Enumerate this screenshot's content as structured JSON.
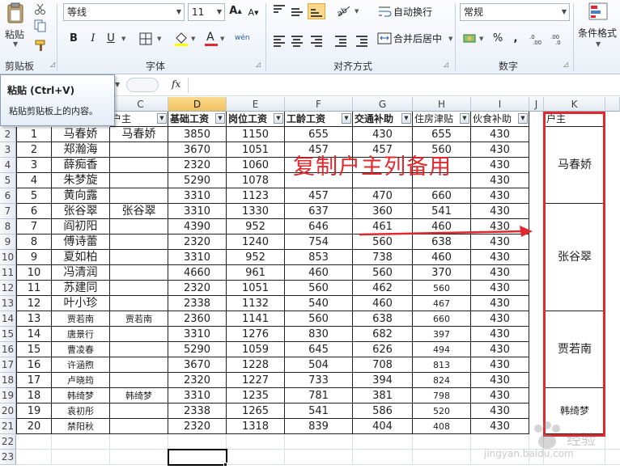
{
  "ribbon": {
    "clipboard": {
      "label": "剪贴板",
      "paste_label": "粘贴"
    },
    "font": {
      "label": "字体",
      "font_name": "等线",
      "font_size": "11",
      "bold": "B",
      "italic": "I",
      "underline": "U",
      "grow": "A",
      "shrink": "A",
      "color_letter": "A",
      "phonetic": "wén"
    },
    "alignment": {
      "label": "对齐方式",
      "wrap": "自动换行",
      "merge": "合并后居中"
    },
    "number": {
      "label": "数字",
      "format": "常规",
      "percent": "%",
      "comma": ","
    },
    "styles": {
      "conditional": "条件格式"
    }
  },
  "tooltip": {
    "title": "粘贴 (Ctrl+V)",
    "desc": "粘贴剪贴板上的内容。"
  },
  "formula": {
    "fx": "fx"
  },
  "columns": [
    "C",
    "D",
    "E",
    "F",
    "G",
    "H",
    "I",
    "J",
    "K"
  ],
  "headers": {
    "owner": "户主",
    "base": "基础工资",
    "post": "岗位工资",
    "seniority": "工龄工资",
    "traffic": "交通补助",
    "housing": "住房津贴",
    "meal": "伙食补助",
    "k_owner": "户主"
  },
  "rows": [
    {
      "row": "2",
      "idx": "1",
      "name": "马春娇",
      "owner": "马春娇",
      "d": "3850",
      "e": "1150",
      "f": "655",
      "g": "430",
      "h": "655",
      "i": "430"
    },
    {
      "row": "3",
      "idx": "2",
      "name": "郑瀚海",
      "owner": "",
      "d": "3670",
      "e": "1051",
      "f": "457",
      "g": "457",
      "h": "560",
      "i": "430"
    },
    {
      "row": "4",
      "idx": "3",
      "name": "薛痴香",
      "owner": "",
      "d": "2320",
      "e": "1060",
      "f": "",
      "g": "",
      "h": "",
      "i": "430"
    },
    {
      "row": "5",
      "idx": "4",
      "name": "朱梦旋",
      "owner": "",
      "d": "5290",
      "e": "1078",
      "f": "",
      "g": "",
      "h": "",
      "i": "430"
    },
    {
      "row": "6",
      "idx": "5",
      "name": "黄向露",
      "owner": "",
      "d": "3310",
      "e": "1123",
      "f": "457",
      "g": "470",
      "h": "660",
      "i": "430"
    },
    {
      "row": "7",
      "idx": "6",
      "name": "张谷翠",
      "owner": "张谷翠",
      "d": "3310",
      "e": "1330",
      "f": "637",
      "g": "360",
      "h": "541",
      "i": "430"
    },
    {
      "row": "8",
      "idx": "7",
      "name": "阎初阳",
      "owner": "",
      "d": "4390",
      "e": "952",
      "f": "646",
      "g": "461",
      "h": "460",
      "i": "430"
    },
    {
      "row": "9",
      "idx": "8",
      "name": "傅诗蕾",
      "owner": "",
      "d": "2320",
      "e": "1240",
      "f": "754",
      "g": "560",
      "h": "638",
      "i": "430"
    },
    {
      "row": "10",
      "idx": "9",
      "name": "夏如柏",
      "owner": "",
      "d": "3310",
      "e": "952",
      "f": "853",
      "g": "738",
      "h": "460",
      "i": "430"
    },
    {
      "row": "11",
      "idx": "10",
      "name": "冯清润",
      "owner": "",
      "d": "4660",
      "e": "961",
      "f": "460",
      "g": "560",
      "h": "370",
      "i": "430"
    },
    {
      "row": "12",
      "idx": "11",
      "name": "苏建同",
      "owner": "",
      "d": "2320",
      "e": "1051",
      "f": "560",
      "g": "462",
      "h": "560",
      "i": "430"
    },
    {
      "row": "13",
      "idx": "12",
      "name": "叶小珍",
      "owner": "",
      "d": "2338",
      "e": "1132",
      "f": "540",
      "g": "460",
      "h": "467",
      "i": "430"
    },
    {
      "row": "14",
      "idx": "13",
      "name": "贾若南",
      "owner": "贾若南",
      "d": "2360",
      "e": "1141",
      "f": "560",
      "g": "638",
      "h": "660",
      "i": "430"
    },
    {
      "row": "15",
      "idx": "14",
      "name": "唐景行",
      "owner": "",
      "d": "3310",
      "e": "1276",
      "f": "830",
      "g": "682",
      "h": "397",
      "i": "430"
    },
    {
      "row": "16",
      "idx": "15",
      "name": "曹凌春",
      "owner": "",
      "d": "5290",
      "e": "1059",
      "f": "645",
      "g": "626",
      "h": "494",
      "i": "430"
    },
    {
      "row": "17",
      "idx": "16",
      "name": "许涵煦",
      "owner": "",
      "d": "3670",
      "e": "1228",
      "f": "504",
      "g": "708",
      "h": "813",
      "i": "430"
    },
    {
      "row": "18",
      "idx": "17",
      "name": "卢晓筠",
      "owner": "",
      "d": "2320",
      "e": "1227",
      "f": "733",
      "g": "394",
      "h": "824",
      "i": "430"
    },
    {
      "row": "19",
      "idx": "18",
      "name": "韩绮梦",
      "owner": "韩绮梦",
      "d": "3310",
      "e": "1235",
      "f": "781",
      "g": "381",
      "h": "798",
      "i": "430"
    },
    {
      "row": "20",
      "idx": "19",
      "name": "袁初彤",
      "owner": "",
      "d": "2338",
      "e": "1265",
      "f": "541",
      "g": "586",
      "h": "520",
      "i": "430"
    },
    {
      "row": "21",
      "idx": "20",
      "name": "禁阳秋",
      "owner": "",
      "d": "2320",
      "e": "1318",
      "f": "839",
      "g": "404",
      "h": "408",
      "i": "430"
    }
  ],
  "extra_rows": [
    "22",
    "23"
  ],
  "k_groups": [
    {
      "label": "马春娇"
    },
    {
      "label": "张谷翠"
    },
    {
      "label": "贾若南"
    },
    {
      "label": "韩绮梦"
    }
  ],
  "annotation": "复制户主列备用",
  "watermark": {
    "brand": "经验",
    "domain": "jingyan.baidu.com"
  },
  "colors": {
    "accent_red": "#e0282d",
    "selected_header": "#f1c15f"
  }
}
